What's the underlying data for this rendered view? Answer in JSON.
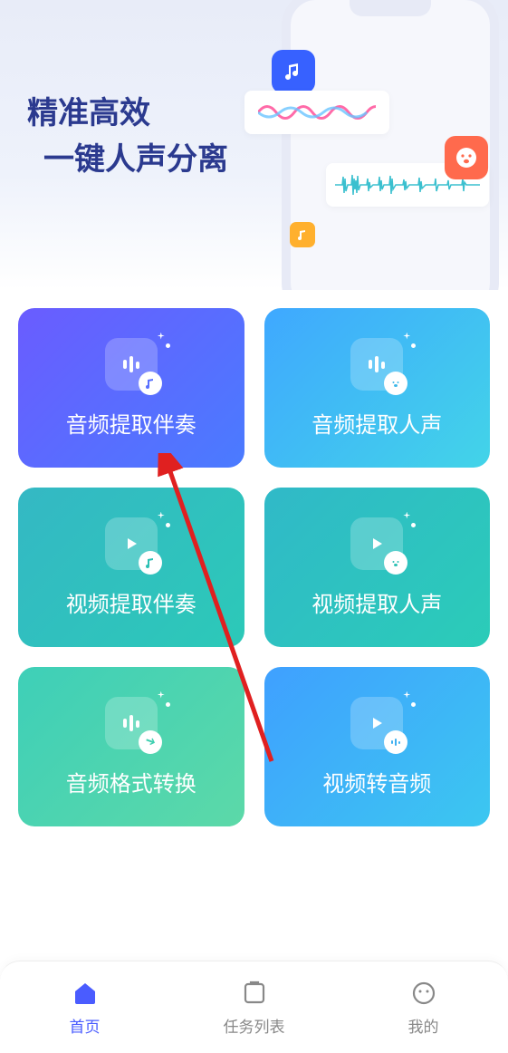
{
  "hero": {
    "line1": "精准高效",
    "line2": "一键人声分离"
  },
  "cards": [
    {
      "label": "音频提取伴奏",
      "icon": "audio-bars",
      "badge": "music-note"
    },
    {
      "label": "音频提取人声",
      "icon": "audio-bars",
      "badge": "face"
    },
    {
      "label": "视频提取伴奏",
      "icon": "video-play",
      "badge": "music-note"
    },
    {
      "label": "视频提取人声",
      "icon": "video-play",
      "badge": "face"
    },
    {
      "label": "音频格式转换",
      "icon": "audio-bars",
      "badge": "convert"
    },
    {
      "label": "视频转音频",
      "icon": "video-play",
      "badge": "audio-bars-mini"
    }
  ],
  "nav": {
    "items": [
      {
        "label": "首页",
        "icon": "home",
        "active": true
      },
      {
        "label": "任务列表",
        "icon": "tasks",
        "active": false
      },
      {
        "label": "我的",
        "icon": "profile",
        "active": false
      }
    ]
  },
  "annotation": {
    "arrow_color": "#e02020"
  }
}
